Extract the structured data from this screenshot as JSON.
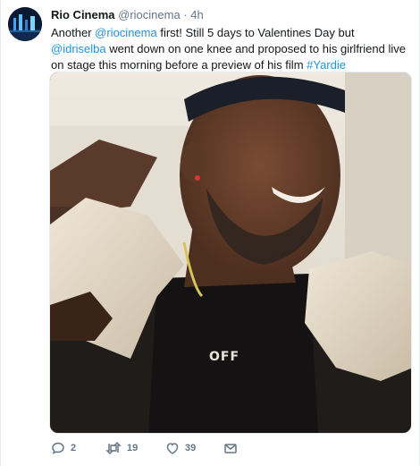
{
  "tweet": {
    "author_name": "Rio Cinema",
    "author_handle": "@riocinema",
    "separator": "·",
    "time": "4h",
    "text_parts": {
      "p1": "Another ",
      "mention1": "@riocinema",
      "p2": " first! Still 5 days to Valentines Day but ",
      "mention2": "@idriselba",
      "p3": " went down on one knee and proposed to his girlfriend live on stage this morning before a preview of his film ",
      "hashtag": "#Yardie"
    },
    "shirt_text": "OFF"
  },
  "actions": {
    "reply_count": "2",
    "retweet_count": "19",
    "like_count": "39"
  },
  "icons": {
    "reply": "reply-icon",
    "retweet": "retweet-icon",
    "like": "heart-icon",
    "message": "envelope-icon"
  },
  "colors": {
    "link": "#1b95e0",
    "secondary_text": "#657786",
    "primary_text": "#14171a"
  }
}
